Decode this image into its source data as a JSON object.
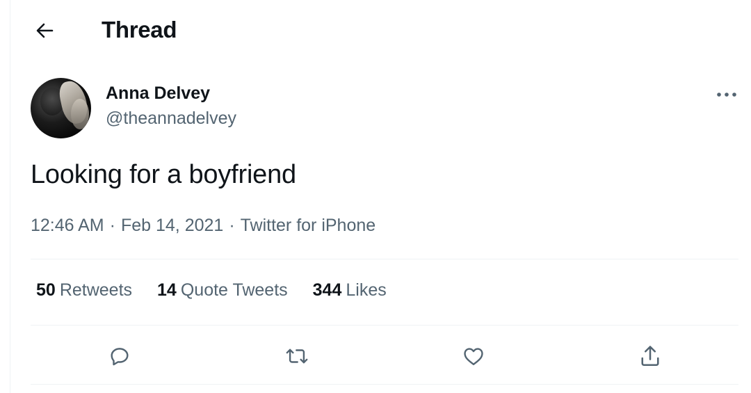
{
  "header": {
    "title": "Thread",
    "back_icon": "arrow-left-icon"
  },
  "tweet": {
    "author_name": "Anna Delvey",
    "author_handle": "@theannadelvey",
    "text": "Looking for a boyfriend",
    "time": "12:46 AM",
    "date": "Feb 14, 2021",
    "source": "Twitter for iPhone",
    "separator": "·"
  },
  "stats": {
    "retweets": {
      "count": "50",
      "label": "Retweets"
    },
    "quote_tweets": {
      "count": "14",
      "label": "Quote Tweets"
    },
    "likes": {
      "count": "344",
      "label": "Likes"
    }
  },
  "actions": [
    "reply-icon",
    "retweet-icon",
    "like-icon",
    "share-icon"
  ],
  "colors": {
    "text": "#0f1419",
    "secondary": "#536471",
    "divider": "#eff3f4"
  }
}
